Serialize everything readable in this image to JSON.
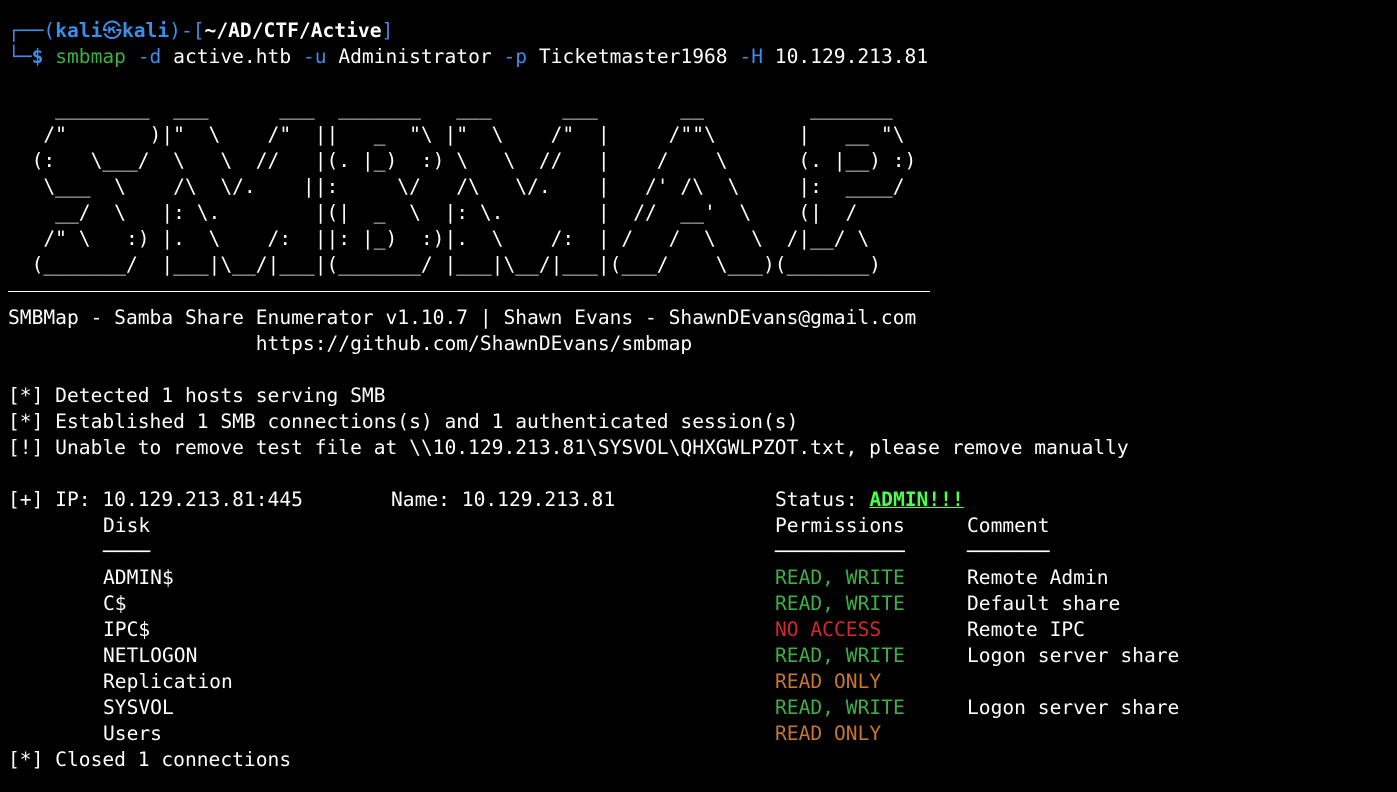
{
  "prompt": {
    "open": "┌──(",
    "user": "kali",
    "at": "㉿",
    "host": "kali",
    "mid": ")-[",
    "path": "~/AD/CTF/Active",
    "close": "]",
    "tail": "└─",
    "dollar": "$"
  },
  "command": {
    "binary": "smbmap",
    "flag_d": "-d",
    "domain": "active.htb",
    "flag_u": "-u",
    "user": "Administrator",
    "flag_p": "-p",
    "password": "Ticketmaster1968",
    "flag_h": "-H",
    "host": "10.129.213.81"
  },
  "banner": [
    "    ________  ___      ___  _______   ___      ___       __         _______",
    "   /\"       )|\"  \\    /\"  ||   _  \"\\ |\"  \\    /\"  |     /\"\"\\       |   __ \"\\",
    "  (:   \\___/  \\   \\  //   |(. |_)  :) \\   \\  //   |    /    \\      (. |__) :)",
    "   \\___  \\    /\\  \\/.    ||:     \\/   /\\   \\/.    |   /' /\\  \\     |:  ____/",
    "    __/  \\   |: \\.        |(|  _  \\  |: \\.        |  //  __'  \\    (|  /",
    "   /\" \\   :) |.  \\    /:  ||: |_)  :)|.  \\    /:  | /   /  \\   \\  /|__/ \\",
    "  (_______/  |___|\\__/|___|(_______/ |___|\\__/|___|(___/    \\___)(_______)"
  ],
  "header": {
    "title": "SMBMap - Samba Share Enumerator v1.10.7 | Shawn Evans - ShawnDEvans@gmail.com",
    "url": "                     https://github.com/ShawnDEvans/smbmap"
  },
  "messages": {
    "detected": "[*] Detected 1 hosts serving SMB",
    "established": "[*] Established 1 SMB connections(s) and 1 authenticated session(s)",
    "unable": "[!] Unable to remove test file at \\\\10.129.213.81\\SYSVOL\\QHXGWLPZOT.txt, please remove manually",
    "closed": "[*] Closed 1 connections"
  },
  "target": {
    "ip_label": "[+] IP: 10.129.213.81:445",
    "name_label": "Name: 10.129.213.81",
    "status_label": "Status: ",
    "status_value": "ADMIN!!!"
  },
  "table": {
    "headers": {
      "disk": "Disk",
      "permissions": "Permissions",
      "comment": "Comment"
    },
    "underlines": {
      "disk": "────",
      "permissions": "───────────",
      "comment": "───────"
    },
    "rows": [
      {
        "disk": "ADMIN$",
        "permissions": "READ, WRITE",
        "comment": "Remote Admin",
        "color": "green"
      },
      {
        "disk": "C$",
        "permissions": "READ, WRITE",
        "comment": "Default share",
        "color": "green"
      },
      {
        "disk": "IPC$",
        "permissions": "NO ACCESS",
        "comment": "Remote IPC",
        "color": "red"
      },
      {
        "disk": "NETLOGON",
        "permissions": "READ, WRITE",
        "comment": "Logon server share",
        "color": "green"
      },
      {
        "disk": "Replication",
        "permissions": "READ ONLY",
        "comment": "",
        "color": "orange"
      },
      {
        "disk": "SYSVOL",
        "permissions": "READ, WRITE",
        "comment": "Logon server share",
        "color": "green"
      },
      {
        "disk": "Users",
        "permissions": "READ ONLY",
        "comment": "",
        "color": "orange"
      }
    ]
  },
  "colors": {
    "background": "#000000",
    "prompt_blue": "#3b8eea",
    "green": "#3cb043",
    "red": "#d22a2a",
    "orange": "#c5782d",
    "admin_green": "#4cff4c"
  }
}
